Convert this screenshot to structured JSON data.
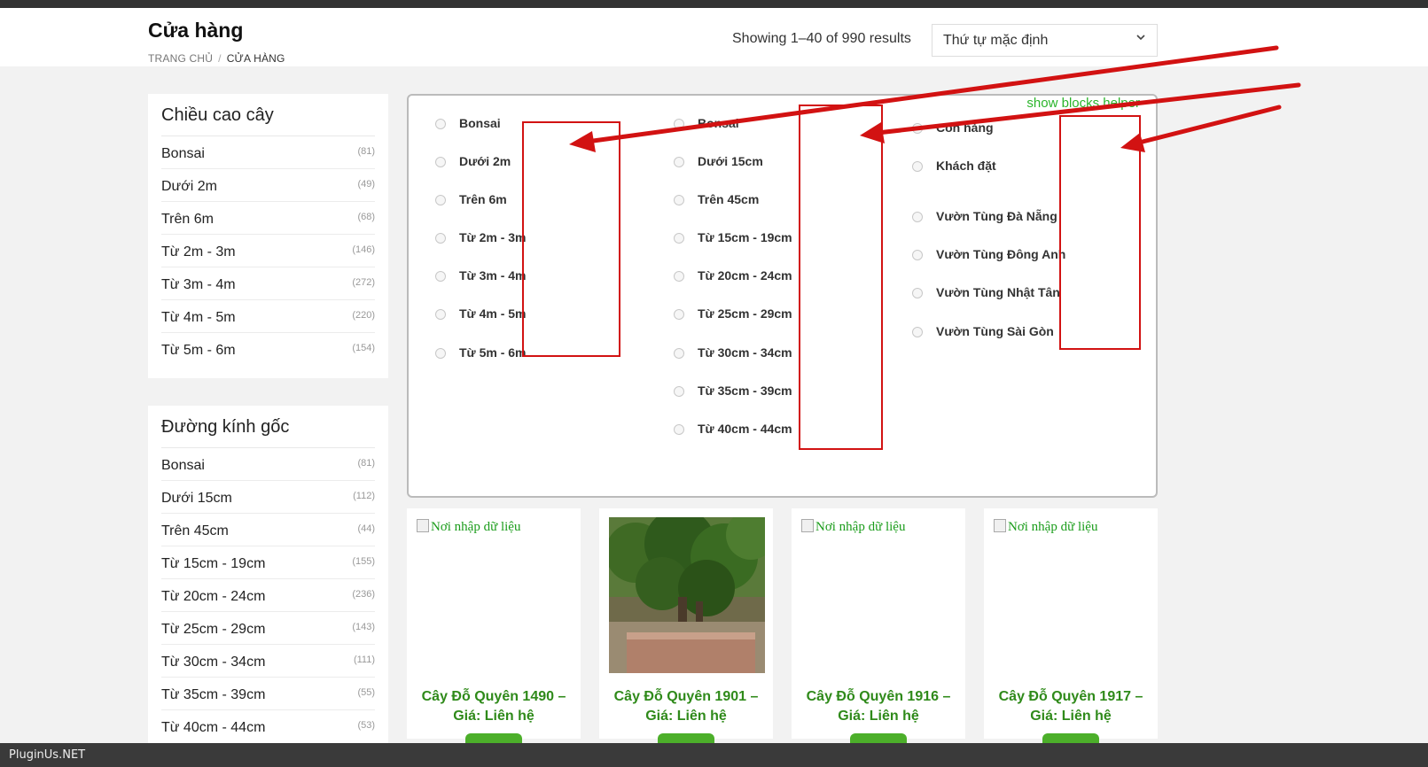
{
  "page": {
    "title": "Cửa hàng",
    "breadcrumb": {
      "home": "TRANG CHỦ",
      "separator": "/",
      "current": "CỬA HÀNG"
    },
    "results_text": "Showing 1–40 of 990 results",
    "order_select": {
      "selected": "Thứ tự mặc định"
    }
  },
  "sidebar": {
    "widgets": [
      {
        "title": "Chiều cao cây",
        "items": [
          {
            "label": "Bonsai",
            "count": "(81)"
          },
          {
            "label": "Dưới 2m",
            "count": "(49)"
          },
          {
            "label": "Trên 6m",
            "count": "(68)"
          },
          {
            "label": "Từ 2m - 3m",
            "count": "(146)"
          },
          {
            "label": "Từ 3m - 4m",
            "count": "(272)"
          },
          {
            "label": "Từ 4m - 5m",
            "count": "(220)"
          },
          {
            "label": "Từ 5m - 6m",
            "count": "(154)"
          }
        ]
      },
      {
        "title": "Đường kính gốc",
        "items": [
          {
            "label": "Bonsai",
            "count": "(81)"
          },
          {
            "label": "Dưới 15cm",
            "count": "(112)"
          },
          {
            "label": "Trên 45cm",
            "count": "(44)"
          },
          {
            "label": "Từ 15cm - 19cm",
            "count": "(155)"
          },
          {
            "label": "Từ 20cm - 24cm",
            "count": "(236)"
          },
          {
            "label": "Từ 25cm - 29cm",
            "count": "(143)"
          },
          {
            "label": "Từ 30cm - 34cm",
            "count": "(111)"
          },
          {
            "label": "Từ 35cm - 39cm",
            "count": "(55)"
          },
          {
            "label": "Từ 40cm - 44cm",
            "count": "(53)"
          }
        ]
      }
    ]
  },
  "filter_box": {
    "helper_link": "show blocks helper",
    "columns": [
      [
        "Bonsai",
        "Dưới 2m",
        "Trên 6m",
        "Từ 2m - 3m",
        "Từ 3m - 4m",
        "Từ 4m - 5m",
        "Từ 5m - 6m"
      ],
      [
        "Bonsai",
        "Dưới 15cm",
        "Trên 45cm",
        "Từ 15cm - 19cm",
        "Từ 20cm - 24cm",
        "Từ 25cm - 29cm",
        "Từ 30cm - 34cm",
        "Từ 35cm - 39cm",
        "Từ 40cm - 44cm"
      ],
      [
        "Còn hàng",
        "Khách đặt",
        "Vườn Tùng Đà Nẵng",
        "Vườn Tùng Đông Anh",
        "Vườn Tùng Nhật Tân",
        "Vườn Tùng Sài Gòn"
      ]
    ]
  },
  "products": [
    {
      "image_alt": "Nơi nhập dữ liệu",
      "name_line1": "Cây Đỗ Quyên 1490 –",
      "name_line2": "Giá: Liên hệ"
    },
    {
      "image_alt": "",
      "name_line1": "Cây Đỗ Quyên 1901 –",
      "name_line2": "Giá: Liên hệ"
    },
    {
      "image_alt": "Nơi nhập dữ liệu",
      "name_line1": "Cây Đỗ Quyên 1916 –",
      "name_line2": "Giá: Liên hệ"
    },
    {
      "image_alt": "Nơi nhập dữ liệu",
      "name_line1": "Cây Đỗ Quyên 1917 –",
      "name_line2": "Giá: Liên hệ"
    }
  ],
  "footer": {
    "text": "PluginUs.NET"
  },
  "colors": {
    "accent_green": "#2f8a1a",
    "annotation_red": "#d21212",
    "helper_green": "#2bb52b"
  }
}
